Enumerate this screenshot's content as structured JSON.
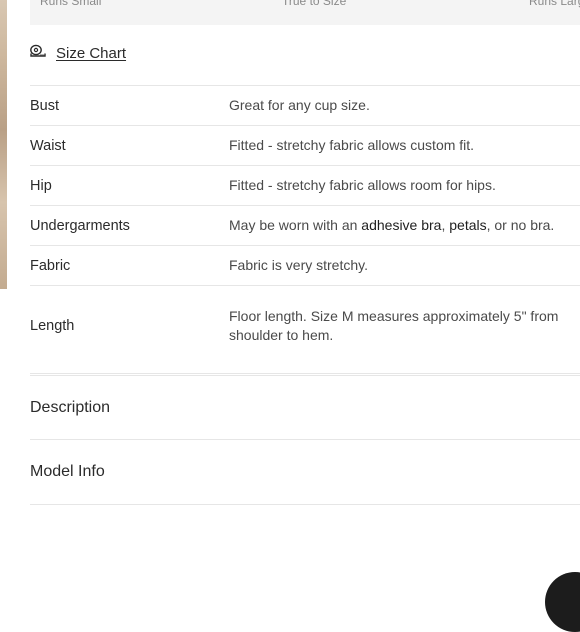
{
  "fit_scale": {
    "labels": [
      "Runs Small",
      "True to Size",
      "Runs Large"
    ]
  },
  "size_chart": {
    "icon": "measuring-tape-icon",
    "label": "Size Chart"
  },
  "fit_details": [
    {
      "key": "Bust",
      "value": "Great for any cup size."
    },
    {
      "key": "Waist",
      "value": "Fitted - stretchy fabric allows custom fit."
    },
    {
      "key": "Hip",
      "value": "Fitted - stretchy fabric allows room for hips."
    },
    {
      "key": "Undergarments",
      "value_prefix": "May be worn with an ",
      "value_link1": "adhesive bra",
      "value_sep": ", ",
      "value_link2": "petals",
      "value_suffix": ", or no bra."
    },
    {
      "key": "Fabric",
      "value": "Fabric is very stretchy."
    },
    {
      "key": "Length",
      "value": "Floor length. Size M measures approximately 5\" from shoulder to hem."
    }
  ],
  "accordions": {
    "description": "Description",
    "model_info": "Model Info"
  },
  "colors": {
    "divider": "#e6e6e6",
    "scale_bg": "#f4f4f4",
    "text": "#2b2b2b"
  }
}
